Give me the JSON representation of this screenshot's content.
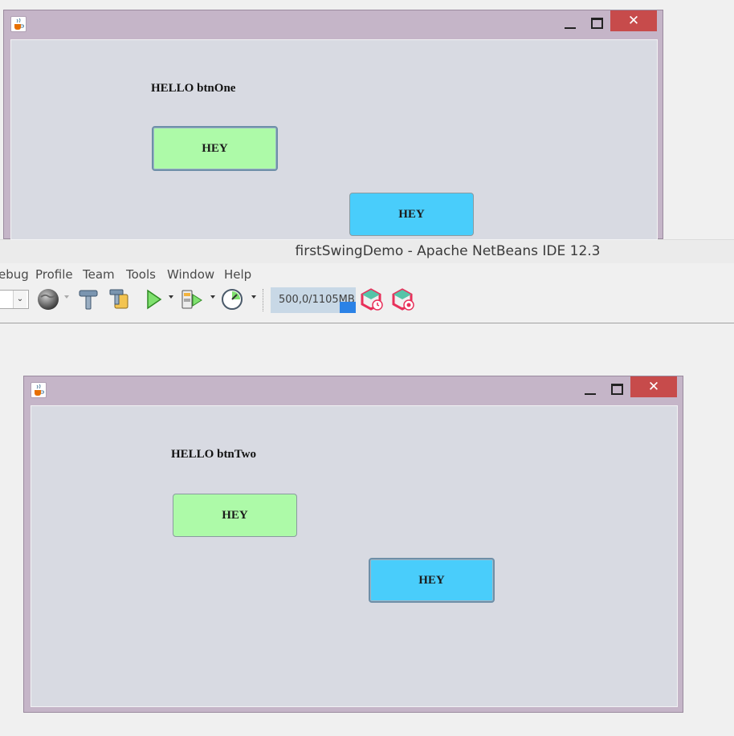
{
  "frame_top": {
    "label": "HELLO btnOne",
    "buttons": [
      {
        "label": "HEY",
        "color": "#adfaa8",
        "focused": true
      },
      {
        "label": "HEY",
        "color": "#49cdfb",
        "focused": false
      }
    ],
    "close_glyph": "✕"
  },
  "netbeans": {
    "title": "firstSwingDemo - Apache NetBeans IDE 12.3",
    "menu": [
      "ebug",
      "Profile",
      "Team",
      "Tools",
      "Window",
      "Help"
    ],
    "toolbar": {
      "combo_arrow": "⌄",
      "icons": [
        "globe-icon",
        "hammer-build-icon",
        "clean-build-icon",
        "run-icon",
        "debug-icon",
        "profile-icon",
        "gc-icon",
        "profile-snapshot-icon"
      ],
      "memory": "500,0/1105MB"
    }
  },
  "frame_bottom": {
    "label": "HELLO btnTwo",
    "buttons": [
      {
        "label": "HEY",
        "color": "#adfaa8",
        "focused": false
      },
      {
        "label": "HEY",
        "color": "#49cdfb",
        "focused": true
      }
    ],
    "close_glyph": "✕"
  },
  "colors": {
    "frame_border": "#c5b5c8",
    "content_bg": "#d8dae2",
    "close_button": "#c74b4b"
  }
}
